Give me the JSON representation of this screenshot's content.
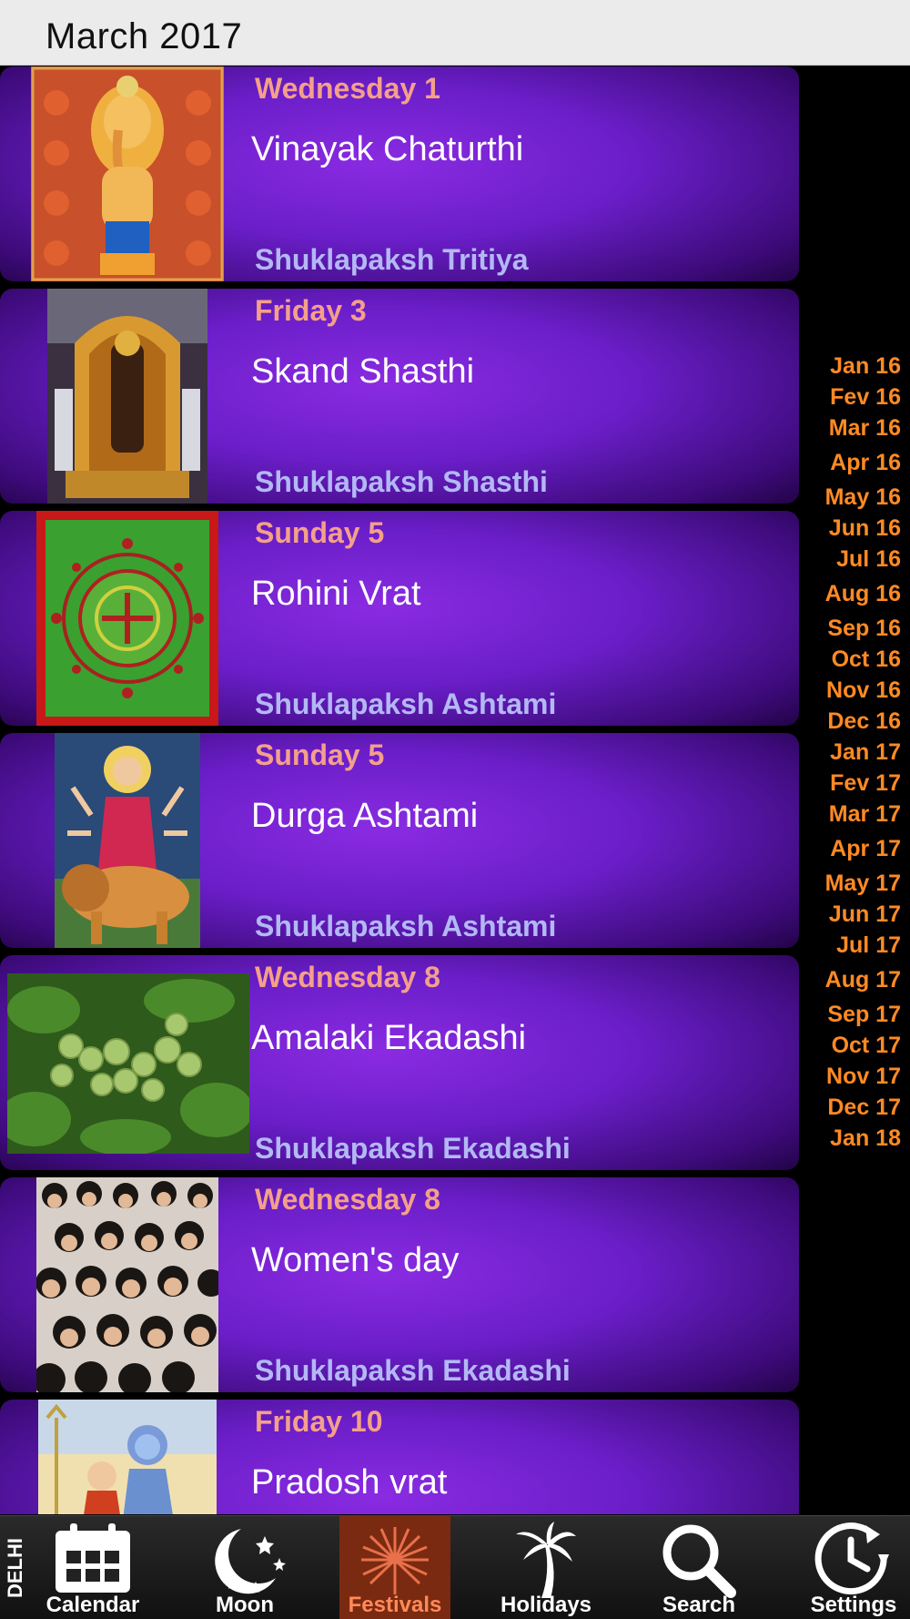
{
  "header": {
    "title": "March 2017"
  },
  "festivals": [
    {
      "date": "Wednesday 1",
      "name": "Vinayak Chaturthi",
      "tithi": "Shuklapaksh Tritiya",
      "image": "ganesha-image"
    },
    {
      "date": "Friday 3",
      "name": "Skand Shasthi",
      "tithi": "Shuklapaksh Shasthi",
      "image": "murugan-image"
    },
    {
      "date": "Sunday 5",
      "name": "Rohini Vrat",
      "tithi": "Shuklapaksh Ashtami",
      "image": "rangoli-image"
    },
    {
      "date": "Sunday 5",
      "name": "Durga Ashtami",
      "tithi": "Shuklapaksh Ashtami",
      "image": "durga-image"
    },
    {
      "date": "Wednesday 8",
      "name": "Amalaki Ekadashi",
      "tithi": "Shuklapaksh Ekadashi",
      "image": "amla-image"
    },
    {
      "date": "Wednesday 8",
      "name": "Women's day",
      "tithi": "Shuklapaksh Ekadashi",
      "image": "crowd-of-women-image"
    },
    {
      "date": "Friday 10",
      "name": "Pradosh vrat",
      "tithi": "",
      "image": "shiva-parvati-image"
    }
  ],
  "month_index": [
    "Jan 16",
    "Fev 16",
    "Mar 16",
    "Apr 16",
    "May 16",
    "Jun 16",
    "Jul 16",
    "Aug 16",
    "Sep 16",
    "Oct 16",
    "Nov 16",
    "Dec 16",
    "Jan 17",
    "Fev 17",
    "Mar 17",
    "Apr 17",
    "May 17",
    "Jun 17",
    "Jul 17",
    "Aug 17",
    "Sep 17",
    "Oct 17",
    "Nov 17",
    "Dec 17",
    "Jan 18"
  ],
  "tabbar": {
    "city": "DELHI",
    "tabs": [
      {
        "label": "Calendar",
        "icon": "calendar-icon"
      },
      {
        "label": "Moon",
        "icon": "moon-stars-icon"
      },
      {
        "label": "Festivals",
        "icon": "fireworks-icon",
        "active": true
      },
      {
        "label": "Holidays",
        "icon": "palm-tree-icon"
      },
      {
        "label": "Search",
        "icon": "search-icon"
      },
      {
        "label": "Settings",
        "icon": "clock-settings-icon"
      }
    ]
  },
  "colors": {
    "date_text": "#f4a08a",
    "tithi_text": "#b3b8f5",
    "index_text": "#ff8a24",
    "card_purple": "#7f25da"
  }
}
